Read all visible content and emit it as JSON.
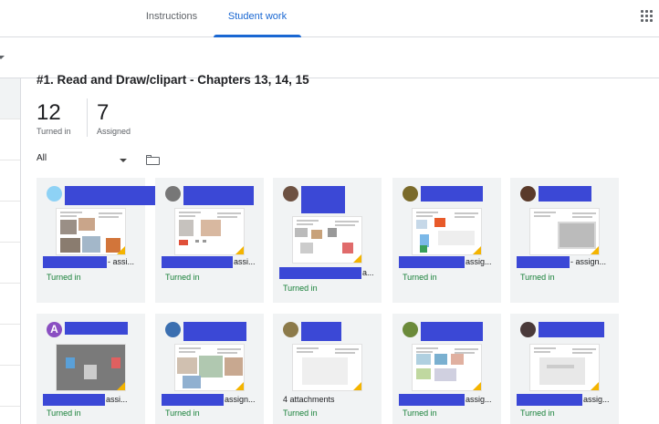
{
  "tabs": {
    "instructions": "Instructions",
    "student_work": "Student work"
  },
  "assignment": {
    "title": "#1. Read and Draw/clipart - Chapters 13, 14, 15"
  },
  "stats": {
    "turned_in_count": "12",
    "turned_in_label": "Turned in",
    "assigned_count": "7",
    "assigned_label": "Assigned"
  },
  "filter": {
    "selected": "All"
  },
  "cards": [
    {
      "suffix": "- assi...",
      "status": "Turned in",
      "avatar_color": "#8ed2f5"
    },
    {
      "suffix": "assi...",
      "status": "Turned in",
      "avatar_color": "#777777"
    },
    {
      "suffix": "a...",
      "status": "Turned in",
      "avatar_color": "#6d5142"
    },
    {
      "suffix": "assig...",
      "status": "Turned in",
      "avatar_color": "#7a6a2a"
    },
    {
      "suffix": "- assign...",
      "status": "Turned in",
      "avatar_color": "#5a3a2a"
    },
    {
      "suffix": "assi...",
      "status": "Turned in",
      "avatar_color": "#8a4fc2",
      "avatar_letter": "A"
    },
    {
      "suffix": "assign...",
      "status": "Turned in",
      "avatar_color": "#3b6fb0"
    },
    {
      "suffix": "4 attachments",
      "status": "Turned in",
      "avatar_color": "#8c7a4a"
    },
    {
      "suffix": "assig...",
      "status": "Turned in",
      "avatar_color": "#6b8a3a"
    },
    {
      "suffix": "assig...",
      "status": "Turned in",
      "avatar_color": "#4a3a3a"
    }
  ],
  "colors": {
    "accent": "#1967d2",
    "turned_in": "#188038",
    "redaction": "#3b48d6",
    "corner": "#f4b400"
  }
}
